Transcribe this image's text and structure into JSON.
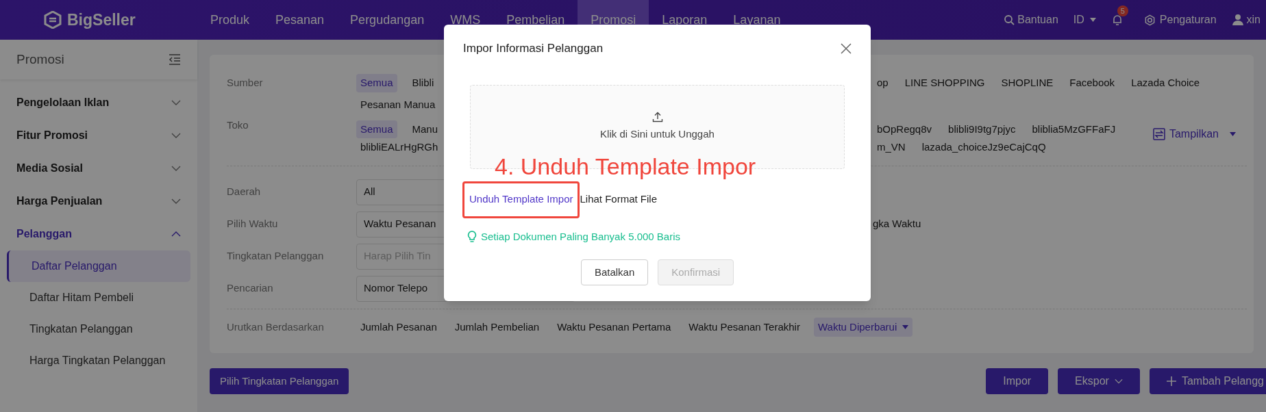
{
  "header": {
    "logo": "BigSeller",
    "nav": [
      {
        "label": "Produk",
        "selected": false
      },
      {
        "label": "Pesanan",
        "selected": false
      },
      {
        "label": "Pergudangan",
        "selected": false
      },
      {
        "label": "WMS",
        "selected": false
      },
      {
        "label": "Pembelian",
        "selected": false
      },
      {
        "label": "Promosi",
        "selected": true
      },
      {
        "label": "Laporan",
        "selected": false
      },
      {
        "label": "Layanan",
        "selected": false
      }
    ],
    "help": "Bantuan",
    "language": "ID",
    "notification_count": "5",
    "settings": "Pengaturan",
    "user": "xin"
  },
  "sidebar": {
    "title": "Promosi",
    "groups": [
      {
        "label": "Pengelolaan Iklan",
        "expanded": false
      },
      {
        "label": "Fitur Promosi",
        "expanded": false
      },
      {
        "label": "Media Sosial",
        "expanded": false
      },
      {
        "label": "Harga Penjualan",
        "expanded": false
      },
      {
        "label": "Pelanggan",
        "expanded": true,
        "items": [
          {
            "label": "Daftar Pelanggan",
            "selected": true
          },
          {
            "label": "Daftar Hitam Pembeli",
            "selected": false
          },
          {
            "label": "Tingkatan Pelanggan",
            "selected": false
          },
          {
            "label": "Harga Tingkatan Pelanggan",
            "selected": false
          }
        ]
      }
    ]
  },
  "filters": {
    "chip_rows": [
      {
        "label": "Sumber",
        "lines": [
          {
            "left_visible": [
              {
                "label": "Semua",
                "selected": true
              },
              {
                "label": "Blibli",
                "selected": false
              }
            ],
            "right_visible": [
              {
                "label": "op",
                "selected": false
              },
              {
                "label": "LINE SHOPPING",
                "selected": false
              },
              {
                "label": "SHOPLINE",
                "selected": false
              },
              {
                "label": "Facebook",
                "selected": false
              },
              {
                "label": "Lazada Choice",
                "selected": false
              }
            ]
          },
          {
            "left_visible": [
              {
                "label": "Pesanan Manua",
                "selected": false
              }
            ]
          }
        ]
      },
      {
        "label": "Toko",
        "display_button": "Tampilkan",
        "lines": [
          {
            "left_visible": [
              {
                "label": "Semua",
                "selected": true
              },
              {
                "label": "Manu",
                "selected": false
              }
            ],
            "right_visible": [
              {
                "label": "bOpRegq8v",
                "selected": false
              },
              {
                "label": "blibli9I9tg7pjyc",
                "selected": false
              },
              {
                "label": "bliblia5MzGFFaFJ",
                "selected": false
              }
            ]
          },
          {
            "left_visible": [
              {
                "label": "blibliEALrHgRGh",
                "selected": false
              }
            ],
            "right_visible": [
              {
                "label": "m_VN",
                "selected": false
              },
              {
                "label": "lazada_choiceJz9eCajCqQ",
                "selected": false
              }
            ]
          }
        ]
      }
    ],
    "selects": [
      {
        "label": "Daerah",
        "value": "All"
      },
      {
        "label": "Pilih Waktu",
        "value": "Waktu Pesanan",
        "right_visible": "gka Waktu"
      },
      {
        "label": "Tingkatan Pelanggan",
        "placeholder": "Harap Pilih Tin"
      },
      {
        "label": "Pencarian",
        "value": "Nomor Telepo"
      }
    ],
    "sort": {
      "label": "Urutkan Berdasarkan",
      "options": [
        {
          "label": "Jumlah Pesanan",
          "selected": false
        },
        {
          "label": "Jumlah Pembelian",
          "selected": false
        },
        {
          "label": "Waktu Pesanan Pertama",
          "selected": false
        },
        {
          "label": "Waktu Pesanan Terakhir",
          "selected": false
        },
        {
          "label": "Waktu Diperbarui",
          "selected": true
        }
      ]
    }
  },
  "actions": {
    "left_button": "Pilih Tingkatan Pelanggan",
    "right_buttons": [
      {
        "label": "Impor",
        "kind": "plain"
      },
      {
        "label": "Ekspor",
        "kind": "dropdown"
      },
      {
        "label": "Tambah Pelangg",
        "kind": "add"
      }
    ]
  },
  "dialog": {
    "title": "Impor Informasi Pelanggan",
    "upload_text": "Klik di Sini untuk Unggah",
    "annotation": "4. Unduh Template Impor",
    "template_link": "Unduh Template Impor",
    "format_link": "Lihat Format File",
    "tip": "Setiap Dokumen Paling Banyak 5.000 Baris",
    "buttons": [
      {
        "label": "Batalkan",
        "disabled": false
      },
      {
        "label": "Konfirmasi",
        "disabled": true
      }
    ]
  }
}
